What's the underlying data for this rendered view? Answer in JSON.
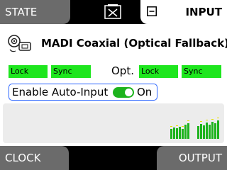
{
  "header": {
    "left_tab": "STATE",
    "center_icon": "x-box-icon",
    "right_tab": "INPUT",
    "right_tab_icon": "minus-box-icon"
  },
  "source": {
    "icon": "coaxial-optical-icon",
    "title": "MADI Coaxial (Optical Fallback)"
  },
  "status": {
    "coax": {
      "lock": "Lock",
      "sync": "Sync"
    },
    "opt_label": "Opt.",
    "optical": {
      "lock": "Lock",
      "sync": "Sync"
    },
    "active_color": "#1ee61e"
  },
  "auto_input": {
    "label": "Enable Auto-Input",
    "state": "On",
    "enabled": true,
    "accent": "#1db31d"
  },
  "footer": {
    "left_tab": "CLOCK",
    "right_tab": "OUTPUT"
  }
}
